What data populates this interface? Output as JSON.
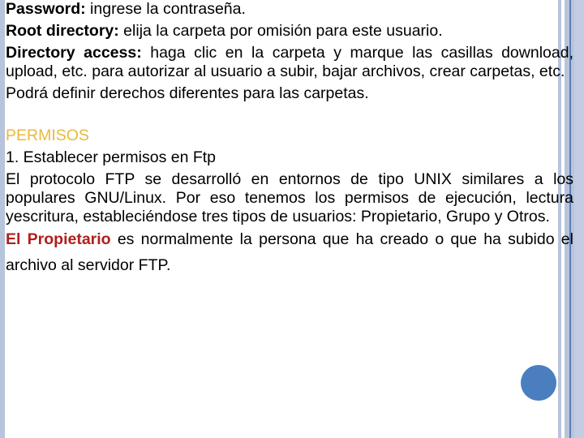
{
  "paragraphs": {
    "password": {
      "label": "Password:",
      "text": " ingrese la contraseña."
    },
    "root_directory": {
      "label": "Root directory:",
      "text": " elija la carpeta por omisión para este usuario."
    },
    "directory_access": {
      "label": "Directory access:",
      "text": " haga clic en la carpeta y marque las casillas download, upload, etc. para autorizar al usuario a subir, bajar archivos, crear carpetas, etc."
    },
    "rights": "Podrá definir derechos diferentes para las carpetas."
  },
  "permisos": {
    "heading": "PERMISOS",
    "step1": "1. Establecer permisos en Ftp",
    "body": "El protocolo FTP se desarrolló en entornos de tipo UNIX similares a los populares GNU/Linux. Por eso tenemos los permisos de ejecución, lectura yescritura, estableciéndose tres tipos de usuarios: Propietario, Grupo y Otros.",
    "owner_label": "El Propietario",
    "owner_text": " es normalmente la persona que ha creado o que ha subido el archivo al servidor FTP."
  },
  "colors": {
    "heading": "#e8b93a",
    "emphasis_red": "#b01e1e",
    "stripe": "#b8c4dc",
    "accent_dot": "#4a7ebf"
  }
}
